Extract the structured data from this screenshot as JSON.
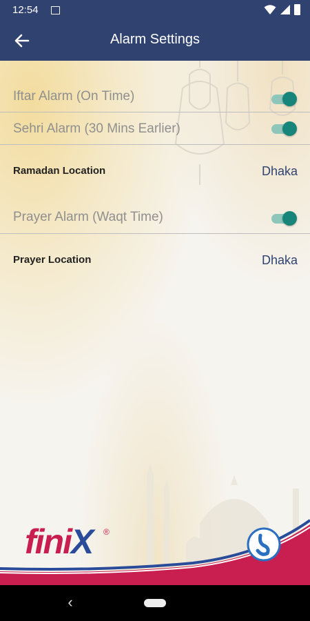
{
  "status_bar": {
    "time": "12:54",
    "icons": [
      "image-icon",
      "wifi-icon",
      "signal-icon",
      "battery-icon"
    ]
  },
  "app_bar": {
    "title": "Alarm Settings",
    "back_icon": "arrow-left-icon",
    "background": "#2f4270"
  },
  "settings": {
    "iftar_alarm": {
      "label": "Iftar Alarm (On Time)",
      "enabled": true
    },
    "sehri_alarm": {
      "label": "Sehri Alarm (30 Mins Earlier)",
      "enabled": true
    },
    "ramadan_location": {
      "label": "Ramadan Location",
      "value": "Dhaka"
    },
    "prayer_alarm": {
      "label": "Prayer Alarm (Waqt Time)",
      "enabled": true
    },
    "prayer_location": {
      "label": "Prayer Location",
      "value": "Dhaka"
    }
  },
  "branding": {
    "logo_main": "fini",
    "logo_x": "X",
    "logo_mark": "®"
  },
  "colors": {
    "toggle_on": "#17857a",
    "toggle_track": "#8fc6bc",
    "accent_navy": "#2f4270",
    "brand_pink": "#c81f50"
  },
  "nav_bar": {
    "back_icon": "chevron-left-icon",
    "home_icon": "home-pill-icon"
  }
}
